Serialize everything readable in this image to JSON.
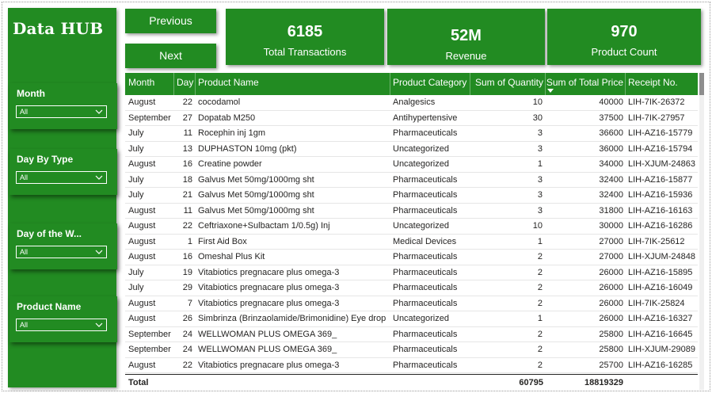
{
  "sidebar": {
    "title": "Data HUB",
    "slicers": [
      {
        "label": "Month",
        "value": "All"
      },
      {
        "label": "Day By Type",
        "value": "All"
      },
      {
        "label": "Day of the W...",
        "value": "All"
      },
      {
        "label": "Product Name",
        "value": "All"
      }
    ]
  },
  "nav": {
    "previous_label": "Previous",
    "next_label": "Next"
  },
  "kpis": [
    {
      "value": "6185",
      "label": "Total Transactions"
    },
    {
      "value": "52M",
      "label": "Revenue"
    },
    {
      "value": "970",
      "label": "Product Count"
    }
  ],
  "table": {
    "columns": [
      "Month",
      "Day",
      "Product Name",
      "Product Category",
      "Sum of Quantity",
      "Sum of Total Price",
      "Receipt No."
    ],
    "sorted_column": "Sum of Total Price",
    "rows": [
      [
        "August",
        "22",
        "cocodamol",
        "Analgesics",
        "10",
        "40000",
        "LIH-7IK-26372"
      ],
      [
        "September",
        "27",
        "Dopatab M250",
        "Antihypertensive",
        "30",
        "37500",
        "LIH-7IK-27957"
      ],
      [
        "July",
        "11",
        "Rocephin inj 1gm",
        "Pharmaceuticals",
        "3",
        "36600",
        "LIH-AZ16-15779"
      ],
      [
        "July",
        "13",
        "DUPHASTON 10mg (pkt)",
        "Uncategorized",
        "3",
        "36000",
        "LIH-AZ16-15794"
      ],
      [
        "August",
        "16",
        "Creatine powder",
        "Uncategorized",
        "1",
        "34000",
        "LIH-XJUM-24863"
      ],
      [
        "July",
        "18",
        "Galvus Met 50mg/1000mg sht",
        "Pharmaceuticals",
        "3",
        "32400",
        "LIH-AZ16-15877"
      ],
      [
        "July",
        "21",
        "Galvus Met 50mg/1000mg sht",
        "Pharmaceuticals",
        "3",
        "32400",
        "LIH-AZ16-15936"
      ],
      [
        "August",
        "11",
        "Galvus Met 50mg/1000mg sht",
        "Pharmaceuticals",
        "3",
        "31800",
        "LIH-AZ16-16163"
      ],
      [
        "August",
        "22",
        "Ceftriaxone+Sulbactam 1/0.5g) Inj",
        "Uncategorized",
        "10",
        "30000",
        "LIH-AZ16-16286"
      ],
      [
        "August",
        "1",
        "First Aid Box",
        "Medical Devices",
        "1",
        "27000",
        "LIH-7IK-25612"
      ],
      [
        "August",
        "16",
        "Omeshal Plus Kit",
        "Pharmaceuticals",
        "2",
        "27000",
        "LIH-XJUM-24848"
      ],
      [
        "July",
        "19",
        "Vitabiotics pregnacare plus omega-3",
        "Pharmaceuticals",
        "2",
        "26000",
        "LIH-AZ16-15895"
      ],
      [
        "July",
        "29",
        "Vitabiotics pregnacare plus omega-3",
        "Pharmaceuticals",
        "2",
        "26000",
        "LIH-AZ16-16049"
      ],
      [
        "August",
        "7",
        "Vitabiotics pregnacare plus omega-3",
        "Pharmaceuticals",
        "2",
        "26000",
        "LIH-7IK-25824"
      ],
      [
        "August",
        "26",
        "Simbrinza (Brinzaolamide/Brimonidine) Eye drop",
        "Uncategorized",
        "1",
        "26000",
        "LIH-AZ16-16327"
      ],
      [
        "September",
        "24",
        "WELLWOMAN PLUS OMEGA 369_",
        "Pharmaceuticals",
        "2",
        "25800",
        "LIH-AZ16-16645"
      ],
      [
        "September",
        "24",
        "WELLWOMAN PLUS OMEGA 369_",
        "Pharmaceuticals",
        "2",
        "25800",
        "LIH-XJUM-29089"
      ],
      [
        "August",
        "22",
        "Vitabiotics pregnacare plus omega-3",
        "Pharmaceuticals",
        "2",
        "25700",
        "LIH-AZ16-16285"
      ]
    ],
    "total": {
      "label": "Total",
      "quantity": "60795",
      "total_price": "18819329"
    }
  },
  "colors": {
    "accent": "#228b22",
    "text": "#252423",
    "background": "#ffffff"
  },
  "icons": {
    "slicer_dropdown": "chevron-down-icon",
    "sort_indicator": "sort-descending-icon"
  }
}
